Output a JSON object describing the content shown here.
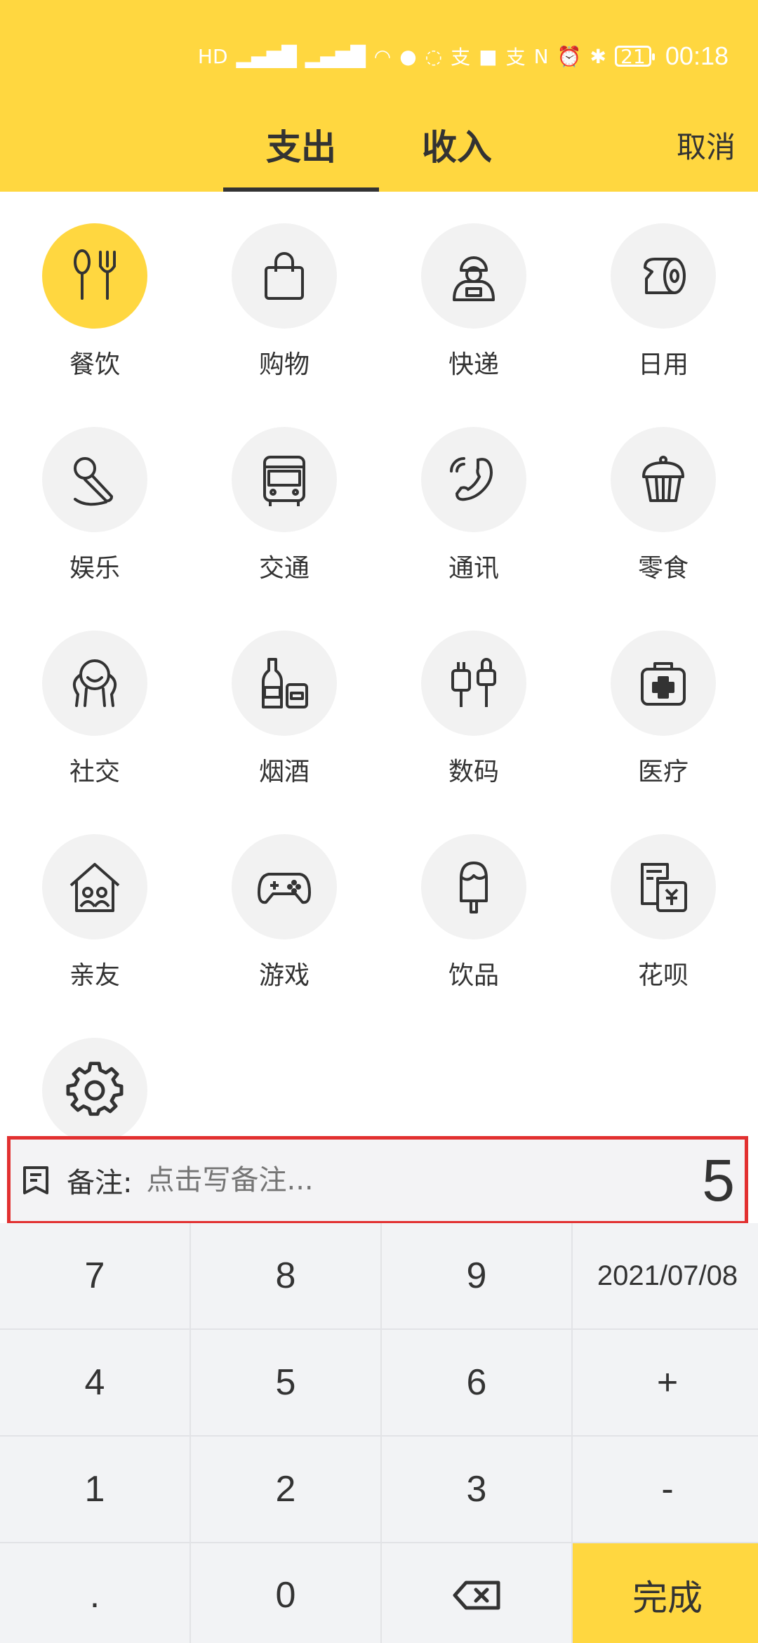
{
  "status_bar": {
    "icons": [
      "hd-icon",
      "signal-4g-icon",
      "signal-4g-icon",
      "wifi-icon",
      "qq-icon",
      "chat-icon",
      "alipay-icon",
      "game-icon",
      "alipay-icon",
      "nfc-icon",
      "alarm-icon",
      "bluetooth-icon"
    ],
    "battery": "21",
    "time": "00:18"
  },
  "tabs": [
    {
      "label": "支出",
      "active": true
    },
    {
      "label": "收入",
      "active": false
    }
  ],
  "cancel_label": "取消",
  "categories": [
    {
      "label": "餐饮",
      "icon": "utensils-icon",
      "active": true
    },
    {
      "label": "购物",
      "icon": "shopping-bag-icon"
    },
    {
      "label": "快递",
      "icon": "courier-icon"
    },
    {
      "label": "日用",
      "icon": "tissue-roll-icon"
    },
    {
      "label": "娱乐",
      "icon": "microphone-icon"
    },
    {
      "label": "交通",
      "icon": "bus-icon"
    },
    {
      "label": "通讯",
      "icon": "phone-icon"
    },
    {
      "label": "零食",
      "icon": "cupcake-icon"
    },
    {
      "label": "社交",
      "icon": "social-icon"
    },
    {
      "label": "烟酒",
      "icon": "bottle-icon"
    },
    {
      "label": "数码",
      "icon": "cable-icon"
    },
    {
      "label": "医疗",
      "icon": "medkit-icon"
    },
    {
      "label": "亲友",
      "icon": "family-house-icon"
    },
    {
      "label": "游戏",
      "icon": "gamepad-icon"
    },
    {
      "label": "饮品",
      "icon": "popsicle-icon"
    },
    {
      "label": "花呗",
      "icon": "bill-icon"
    },
    {
      "label": "",
      "icon": "settings-gear-icon"
    }
  ],
  "note": {
    "label": "备注:",
    "placeholder": "点击写备注...",
    "amount": "5"
  },
  "keypad": {
    "k7": "7",
    "k8": "8",
    "k9": "9",
    "date": "2021/07/08",
    "k4": "4",
    "k5": "5",
    "k6": "6",
    "plus": "+",
    "k1": "1",
    "k2": "2",
    "k3": "3",
    "minus": "-",
    "dot": ".",
    "k0": "0",
    "done": "完成"
  }
}
